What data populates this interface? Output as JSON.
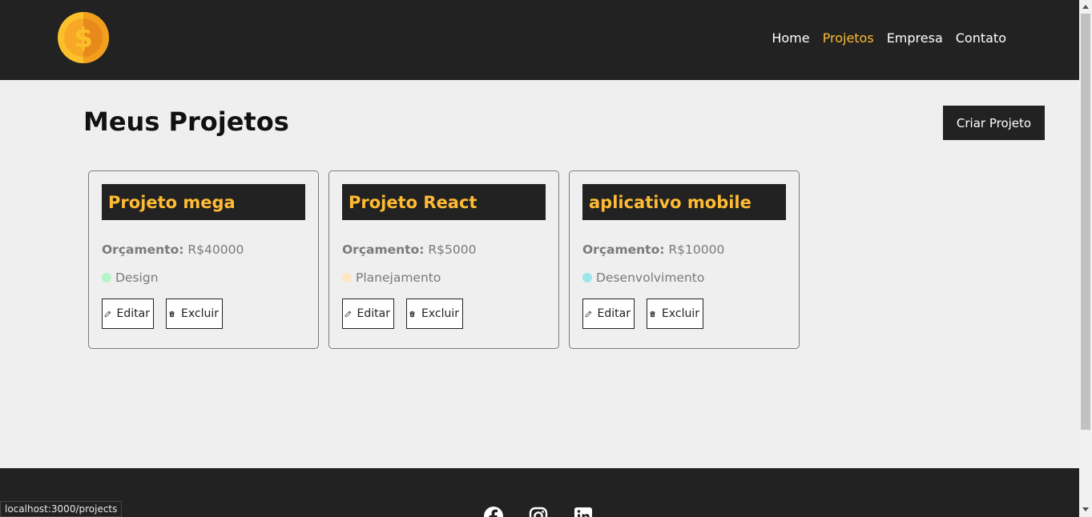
{
  "navbar": {
    "logo_icon": "coin-dollar-icon",
    "links": [
      {
        "label": "Home",
        "active": false
      },
      {
        "label": "Projetos",
        "active": true
      },
      {
        "label": "Empresa",
        "active": false
      },
      {
        "label": "Contato",
        "active": false
      }
    ]
  },
  "main": {
    "title": "Meus Projetos",
    "create_button": "Criar Projeto"
  },
  "projects": [
    {
      "name": "Projeto mega",
      "budget_label": "Orçamento:",
      "budget_value": "R$40000",
      "category": "Design",
      "category_color": "#b5f5c8",
      "edit_label": "Editar",
      "delete_label": "Excluir"
    },
    {
      "name": "Projeto React",
      "budget_label": "Orçamento:",
      "budget_value": "R$5000",
      "category": "Planejamento",
      "category_color": "#fde6c0",
      "edit_label": "Editar",
      "delete_label": "Excluir"
    },
    {
      "name": "aplicativo mobile",
      "budget_label": "Orçamento:",
      "budget_value": "R$10000",
      "category": "Desenvolvimento",
      "category_color": "#9be7ea",
      "edit_label": "Editar",
      "delete_label": "Excluir"
    }
  ],
  "footer": {
    "social_icons": [
      "facebook-icon",
      "instagram-icon",
      "linkedin-icon"
    ]
  },
  "status_bar": {
    "url": "localhost:3000/projects"
  },
  "colors": {
    "dark": "#222222",
    "accent": "#ffbb33",
    "background": "#efefef"
  }
}
